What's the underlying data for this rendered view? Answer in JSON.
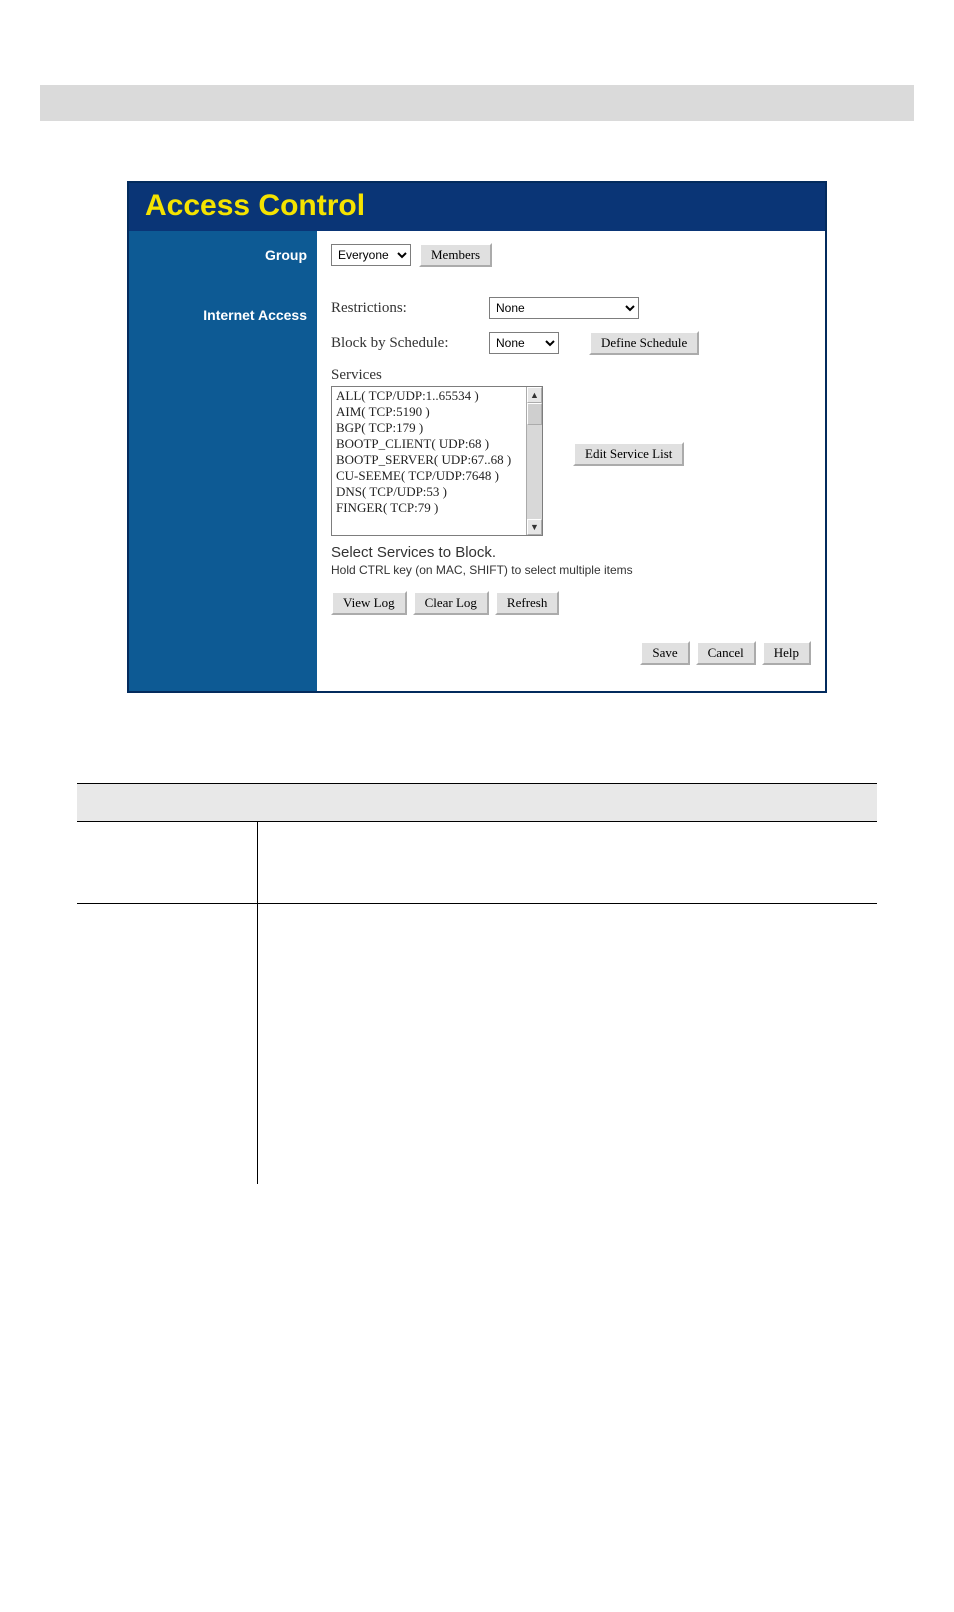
{
  "page": {
    "title": "Access Control"
  },
  "sidebar": {
    "group_label": "Group",
    "internet_label": "Internet Access"
  },
  "group": {
    "select": {
      "selected": "Everyone",
      "options": [
        "Everyone"
      ]
    },
    "members_button": "Members"
  },
  "internet": {
    "restrictions_label": "Restrictions:",
    "restrictions_select": {
      "selected": "None",
      "options": [
        "None"
      ]
    },
    "block_label": "Block by Schedule:",
    "block_select": {
      "selected": "None",
      "options": [
        "None"
      ]
    },
    "define_schedule_button": "Define Schedule",
    "services_label": "Services",
    "services_items": [
      "ALL( TCP/UDP:1..65534 )",
      "AIM( TCP:5190 )",
      "BGP( TCP:179 )",
      "BOOTP_CLIENT( UDP:68 )",
      "BOOTP_SERVER( UDP:67..68 )",
      "CU-SEEME( TCP/UDP:7648 )",
      "DNS( TCP/UDP:53 )",
      "FINGER( TCP:79 )"
    ],
    "edit_service_list_button": "Edit Service List",
    "select_hint_main": "Select Services to Block.",
    "select_hint_sub": "Hold CTRL key (on MAC, SHIFT) to select multiple items",
    "buttons": {
      "view_log": "View Log",
      "clear_log": "Clear Log",
      "refresh": "Refresh"
    }
  },
  "footer_buttons": {
    "save": "Save",
    "cancel": "Cancel",
    "help": "Help"
  }
}
